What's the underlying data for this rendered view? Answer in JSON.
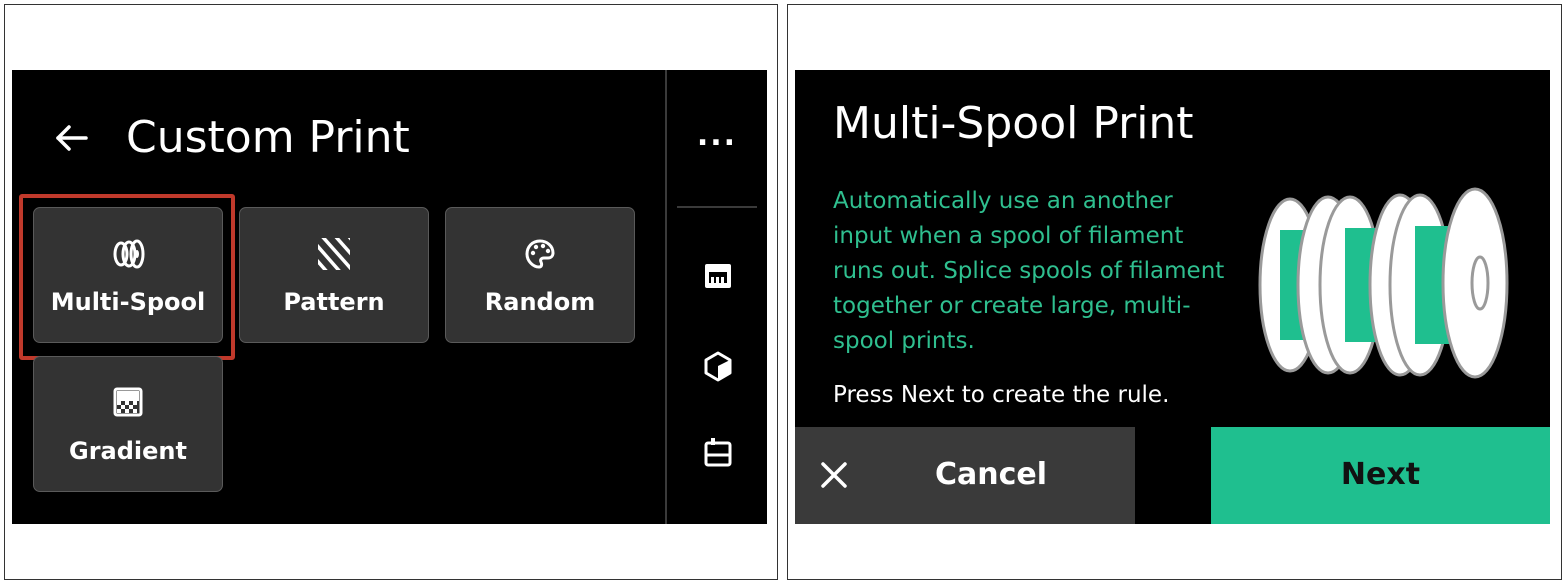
{
  "left": {
    "header": {
      "title": "Custom Print",
      "back_icon": "back-arrow-icon"
    },
    "tiles": [
      {
        "label": "Multi-Spool",
        "icon": "multi-spool-icon",
        "selected": true
      },
      {
        "label": "Pattern",
        "icon": "pattern-icon",
        "selected": false
      },
      {
        "label": "Random",
        "icon": "palette-icon",
        "selected": false
      },
      {
        "label": "Gradient",
        "icon": "gradient-icon",
        "selected": false
      }
    ],
    "rail": {
      "more": "...",
      "icons": [
        "printer-icon",
        "cube-icon",
        "storage-icon"
      ]
    },
    "colors": {
      "highlight": "#c0392b",
      "tile_bg": "#333333"
    }
  },
  "right": {
    "title": "Multi-Spool Print",
    "description_lines": [
      "Automatically use an another",
      "input when a spool of filament",
      "runs out. Splice spools of filament",
      "together or create large, multi-",
      "spool prints."
    ],
    "hint": "Press Next to create the rule.",
    "cancel_label": "Cancel",
    "next_label": "Next",
    "colors": {
      "accent": "#1fbf8f",
      "description": "#2fbf8f"
    }
  }
}
